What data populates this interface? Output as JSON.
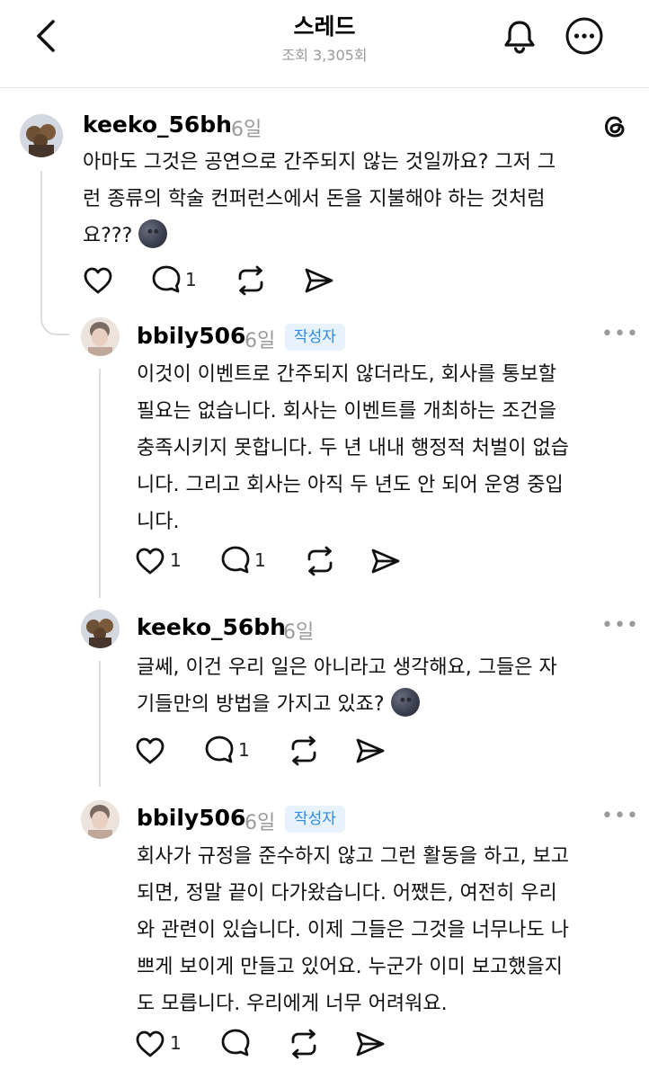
{
  "header": {
    "title": "스레드",
    "views": "조회 3,305회"
  },
  "posts": [
    {
      "username": "keeko_56bh",
      "time": "6일",
      "lines": [
        "아마도 그것은 공연으로 간주되지 않는 것일까요? 그저 그",
        "런 종류의 학술 컨퍼런스에서 돈을 지불해야 하는 것처럼",
        "요???"
      ],
      "emoji": "new-moon-face",
      "like_count": "",
      "reply_count": "1"
    },
    {
      "username": "bbily506",
      "time": "6일",
      "badge": "작성자",
      "lines": [
        "이것이 이벤트로 간주되지 않더라도, 회사를 통보할",
        "필요는 없습니다. 회사는 이벤트를 개최하는 조건을",
        "충족시키지 못합니다. 두 년 내내 행정적 처벌이 없습",
        "니다. 그리고 회사는 아직 두 년도 안 되어 운영 중입",
        "니다."
      ],
      "like_count": "1",
      "reply_count": "1"
    },
    {
      "username": "keeko_56bh",
      "time": "6일",
      "lines": [
        "글쎄, 이건 우리 일은 아니라고 생각해요, 그들은 자",
        "기들만의 방법을 가지고 있죠?"
      ],
      "emoji": "new-moon-face",
      "like_count": "",
      "reply_count": "1"
    },
    {
      "username": "bbily506",
      "time": "6일",
      "badge": "작성자",
      "lines": [
        "회사가 규정을 준수하지 않고 그런 활동을 하고, 보고",
        "되면, 정말 끝이 다가왔습니다. 어쨌든, 여전히 우리",
        "와 관련이 있습니다. 이제 그들은 그것을 너무나도 나",
        "쁘게 보이게 만들고 있어요. 누군가 이미 보고했을지",
        "도 모릅니다. 우리에게 너무 어려워요."
      ],
      "like_count": "1",
      "reply_count": ""
    }
  ]
}
